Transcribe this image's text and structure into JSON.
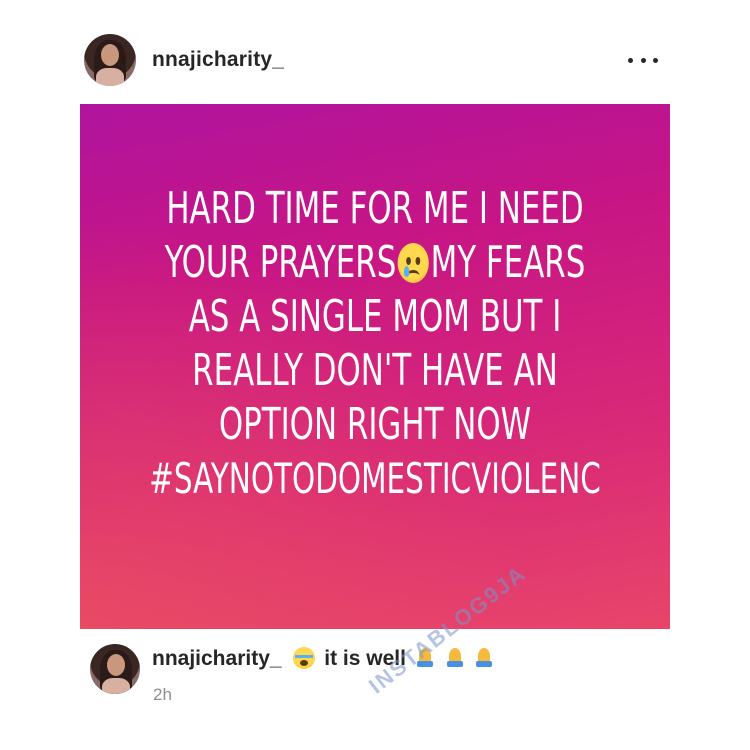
{
  "post": {
    "username": "nnajicharity_",
    "image_text_lines": [
      "HARD TIME FOR ME I NEED",
      "YOUR PRAYERS",
      "MY FEARS",
      "AS A SINGLE MOM BUT I",
      "REALLY DON'T HAVE AN",
      "OPTION RIGHT NOW",
      "#SAYNOTODOMESTICVIOLENC"
    ],
    "image_gradient": [
      "#b0149e",
      "#c71585",
      "#d82878",
      "#e8456a"
    ]
  },
  "caption": {
    "username": "nnajicharity_",
    "text": "it is well",
    "emoji_before": "crying-face-emoji",
    "emoji_after": [
      "folded-hands-emoji",
      "folded-hands-emoji",
      "folded-hands-emoji"
    ]
  },
  "timestamp": "2h",
  "watermark": "INSTABLOG9JA",
  "icons": {
    "more": "more-horizontal-icon",
    "sad_face": "sad-tear-face-emoji"
  }
}
